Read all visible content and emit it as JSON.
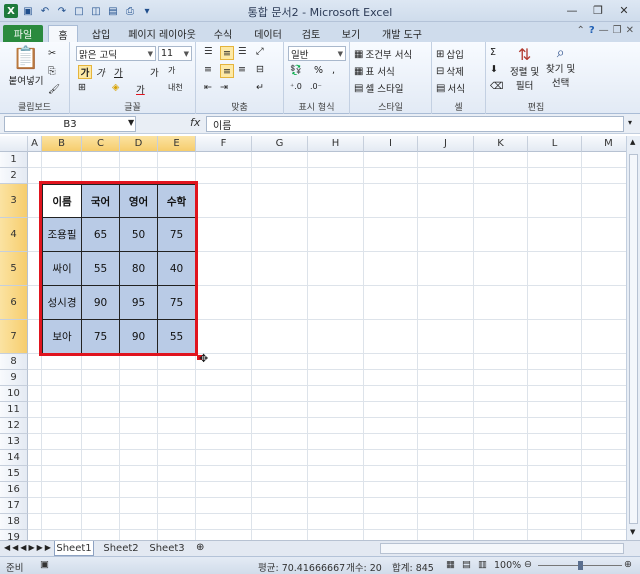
{
  "window": {
    "title": "통합 문서2 - Microsoft Excel"
  },
  "tabs": [
    "파일",
    "홈",
    "삽입",
    "페이지 레이아웃",
    "수식",
    "데이터",
    "검토",
    "보기",
    "개발 도구"
  ],
  "ribbon": {
    "clipboard": {
      "paste": "붙여넣기",
      "label": "클립보드"
    },
    "font": {
      "name": "맑은 고딕",
      "size": "11",
      "label": "글꼴",
      "bold": "가",
      "italic": "가",
      "underline": "가",
      "grow": "가",
      "shrink": "가",
      "color_letter": "가",
      "phonetic": "내천"
    },
    "align": {
      "label": "맞춤"
    },
    "number": {
      "format": "일반",
      "label": "표시 형식",
      "percent": "%"
    },
    "styles": {
      "cond": "조건부 서식",
      "table": "표 서식",
      "cell": "셀 스타일",
      "label": "스타일"
    },
    "cells": {
      "insert": "삽입",
      "delete": "삭제",
      "format": "서식",
      "label": "셀"
    },
    "edit": {
      "sort": "정렬 및",
      "sort2": "필터",
      "find": "찾기 및",
      "find2": "선택",
      "label": "편집"
    }
  },
  "formula_bar": {
    "name_box": "B3",
    "fx": "fx",
    "content": "이름"
  },
  "columns": [
    "A",
    "B",
    "C",
    "D",
    "E",
    "F",
    "G",
    "H",
    "I",
    "J",
    "K",
    "L",
    "M"
  ],
  "rows": [
    "1",
    "2",
    "3",
    "4",
    "5",
    "6",
    "7",
    "8",
    "9",
    "10",
    "11",
    "12",
    "13",
    "14",
    "15",
    "16",
    "17",
    "18",
    "19"
  ],
  "table": {
    "headers": [
      "이름",
      "국어",
      "영어",
      "수학"
    ],
    "rows": [
      [
        "조용필",
        "65",
        "50",
        "75"
      ],
      [
        "싸이",
        "55",
        "80",
        "40"
      ],
      [
        "성시경",
        "90",
        "95",
        "75"
      ],
      [
        "보아",
        "75",
        "90",
        "55"
      ]
    ]
  },
  "sheets": [
    "Sheet1",
    "Sheet2",
    "Sheet3"
  ],
  "status": {
    "ready": "준비",
    "average": "평균: 70.41666667",
    "count": "개수: 20",
    "sum": "합계: 845",
    "zoom": "100%"
  },
  "colors": {
    "selection_border": "#e0141e",
    "cell_fill": "#b9cbe6",
    "file_tab": "#2a8a3e"
  }
}
